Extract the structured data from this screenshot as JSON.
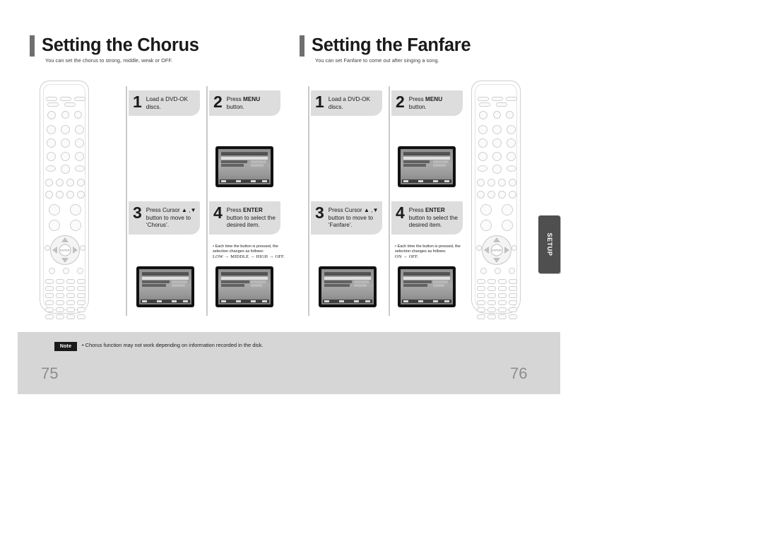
{
  "document": {
    "type": "manual-spread",
    "sections": [
      {
        "id": "chorus",
        "title": "Setting the Chorus",
        "subtitle": "You can set the chorus to strong, middle, weak or OFF.",
        "steps": [
          {
            "number": "1",
            "text_before": "Load a DVD-OK discs.",
            "bold": "",
            "text_after": "",
            "has_tv": false
          },
          {
            "number": "2",
            "text_before": "Press ",
            "bold": "MENU",
            "text_after": " button.",
            "has_tv": true
          },
          {
            "number": "3",
            "text_before": "Press Cursor ▲ ,▼ button to move to ‘Chorus’.",
            "bold": "",
            "text_after": "",
            "has_tv": true
          },
          {
            "number": "4",
            "text_before": "Press ",
            "bold": "ENTER",
            "text_after": " button to select the desired item.",
            "has_tv": true
          }
        ],
        "step_note": {
          "bullet": "• Each time the button is pressed, the selection changes as follows:",
          "sequence": "LOW → MIDDLE → HIGH → OFF."
        },
        "page_number": "75"
      },
      {
        "id": "fanfare",
        "title": "Setting the Fanfare",
        "subtitle": "You can set Fanfare to come out after singing a song.",
        "steps": [
          {
            "number": "1",
            "text_before": "Load a DVD-OK discs.",
            "bold": "",
            "text_after": "",
            "has_tv": false
          },
          {
            "number": "2",
            "text_before": "Press ",
            "bold": "MENU",
            "text_after": " button.",
            "has_tv": true
          },
          {
            "number": "3",
            "text_before": "Press Cursor ▲ ,▼ button to move to ‘Fanfare’.",
            "bold": "",
            "text_after": "",
            "has_tv": true
          },
          {
            "number": "4",
            "text_before": "Press ",
            "bold": "ENTER",
            "text_after": " button to select the desired item.",
            "has_tv": true
          }
        ],
        "step_note": {
          "bullet": "• Each time the button is pressed, the selection changes as follows:",
          "sequence": "ON → OFF."
        },
        "page_number": "76"
      }
    ]
  },
  "note_box": {
    "badge": "Note",
    "text": "• Chorus function may not work depending on information recorded in the disk."
  },
  "side_tab": {
    "label": "SETUP"
  },
  "remotes": {
    "left": {
      "name": "remote-control-left",
      "caption": ""
    },
    "right": {
      "name": "remote-control-right",
      "caption": ""
    }
  },
  "colors": {
    "heading_bar": "#6f6f6f",
    "step_box": "#dddddd",
    "rule": "#c9c9c9",
    "foot_band": "#d6d6d6",
    "side_tab": "#4f4f4f",
    "page_number": "#8d8d8d"
  }
}
